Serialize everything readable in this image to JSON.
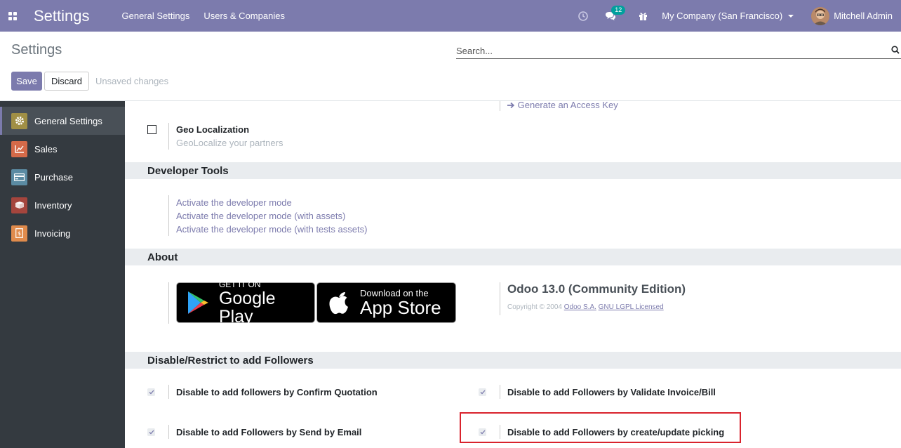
{
  "navbar": {
    "brand": "Settings",
    "menu": [
      "General Settings",
      "Users & Companies"
    ],
    "messages_count": "12",
    "company": "My Company (San Francisco)",
    "user": "Mitchell Admin"
  },
  "control_panel": {
    "title": "Settings",
    "search_placeholder": "Search...",
    "save_label": "Save",
    "discard_label": "Discard",
    "unsaved": "Unsaved changes"
  },
  "sidebar": {
    "items": [
      {
        "label": "General Settings",
        "icon": "gear-icon",
        "color": "#a08f45"
      },
      {
        "label": "Sales",
        "icon": "chart-icon",
        "color": "#d56a49"
      },
      {
        "label": "Purchase",
        "icon": "credit-card-icon",
        "color": "#5b8ba3"
      },
      {
        "label": "Inventory",
        "icon": "box-icon",
        "color": "#a5453d"
      },
      {
        "label": "Invoicing",
        "icon": "invoice-icon",
        "color": "#e08b4c"
      }
    ]
  },
  "content": {
    "access_key_link": "Generate an Access Key",
    "geo": {
      "title": "Geo Localization",
      "desc": "GeoLocalize your partners"
    },
    "developer_tools": {
      "header": "Developer Tools",
      "links": [
        "Activate the developer mode",
        "Activate the developer mode (with assets)",
        "Activate the developer mode (with tests assets)"
      ]
    },
    "about": {
      "header": "About",
      "google_play_top": "GET IT ON",
      "google_play_bottom": "Google Play",
      "app_store_top": "Download on the",
      "app_store_bottom": "App Store",
      "version": "Odoo 13.0 (Community Edition)",
      "copyright_prefix": "Copyright © 2004",
      "company_link": "Odoo S.A.",
      "license_link": "GNU LGPL Licensed"
    },
    "followers": {
      "header": "Disable/Restrict to add Followers",
      "options": [
        "Disable to add followers by Confirm Quotation",
        "Disable to add Followers by Validate Invoice/Bill",
        "Disable to add Followers by Send by Email",
        "Disable to add Followers by create/update picking"
      ]
    }
  }
}
